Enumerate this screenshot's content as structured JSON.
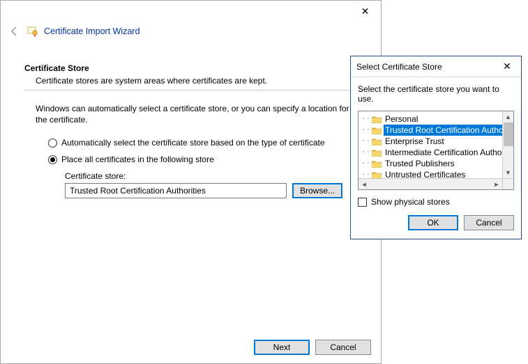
{
  "wizard": {
    "title": "Certificate Import Wizard",
    "section_title": "Certificate Store",
    "section_subtitle": "Certificate stores are system areas where certificates are kept.",
    "paragraph": "Windows can automatically select a certificate store, or you can specify a location for the certificate.",
    "radio_auto": "Automatically select the certificate store based on the type of certificate",
    "radio_place": "Place all certificates in the following store",
    "store_label": "Certificate store:",
    "store_value": "Trusted Root Certification Authorities",
    "browse_label": "Browse...",
    "next_label": "Next",
    "cancel_label": "Cancel"
  },
  "dialog": {
    "title": "Select Certificate Store",
    "prompt": "Select the certificate store you want to use.",
    "items": [
      "Personal",
      "Trusted Root Certification Authorities",
      "Enterprise Trust",
      "Intermediate Certification Authorities",
      "Trusted Publishers",
      "Untrusted Certificates"
    ],
    "selected_index": 1,
    "show_physical_label": "Show physical stores",
    "ok_label": "OK",
    "cancel_label": "Cancel"
  }
}
